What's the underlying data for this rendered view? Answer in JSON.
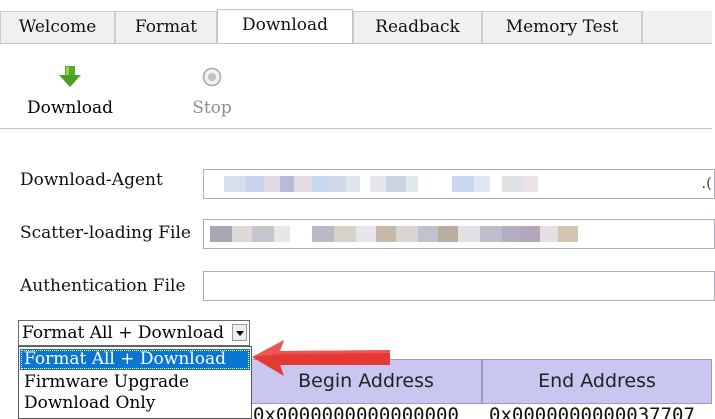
{
  "tabs": [
    {
      "label": "Welcome",
      "active": false
    },
    {
      "label": "Format",
      "active": false
    },
    {
      "label": "Download",
      "active": true
    },
    {
      "label": "Readback",
      "active": false
    },
    {
      "label": "Memory Test",
      "active": false
    }
  ],
  "toolbar": {
    "download_label": "Download",
    "stop_label": "Stop",
    "download_icon": "green-down-arrow-icon",
    "stop_icon": "stop-circle-icon"
  },
  "form": {
    "download_agent_label": "Download-Agent",
    "download_agent_value_tail": ".(",
    "scatter_label": "Scatter-loading File",
    "auth_label": "Authentication File",
    "auth_value": ""
  },
  "dropdown": {
    "selected": "Format All + Download",
    "options": [
      "Format All + Download",
      "Firmware Upgrade",
      "Download Only"
    ],
    "highlighted_index": 0
  },
  "table": {
    "headers": [
      "Begin Address",
      "End Address"
    ],
    "first_row": {
      "name": "",
      "begin": "0x0000000000000000",
      "end": "0x0000000000037707"
    }
  },
  "colors": {
    "accent_selection": "#0a76d2",
    "header_bg": "#c9c6ef",
    "annotation_arrow": "#e53935",
    "download_icon": "#5aa82a"
  }
}
